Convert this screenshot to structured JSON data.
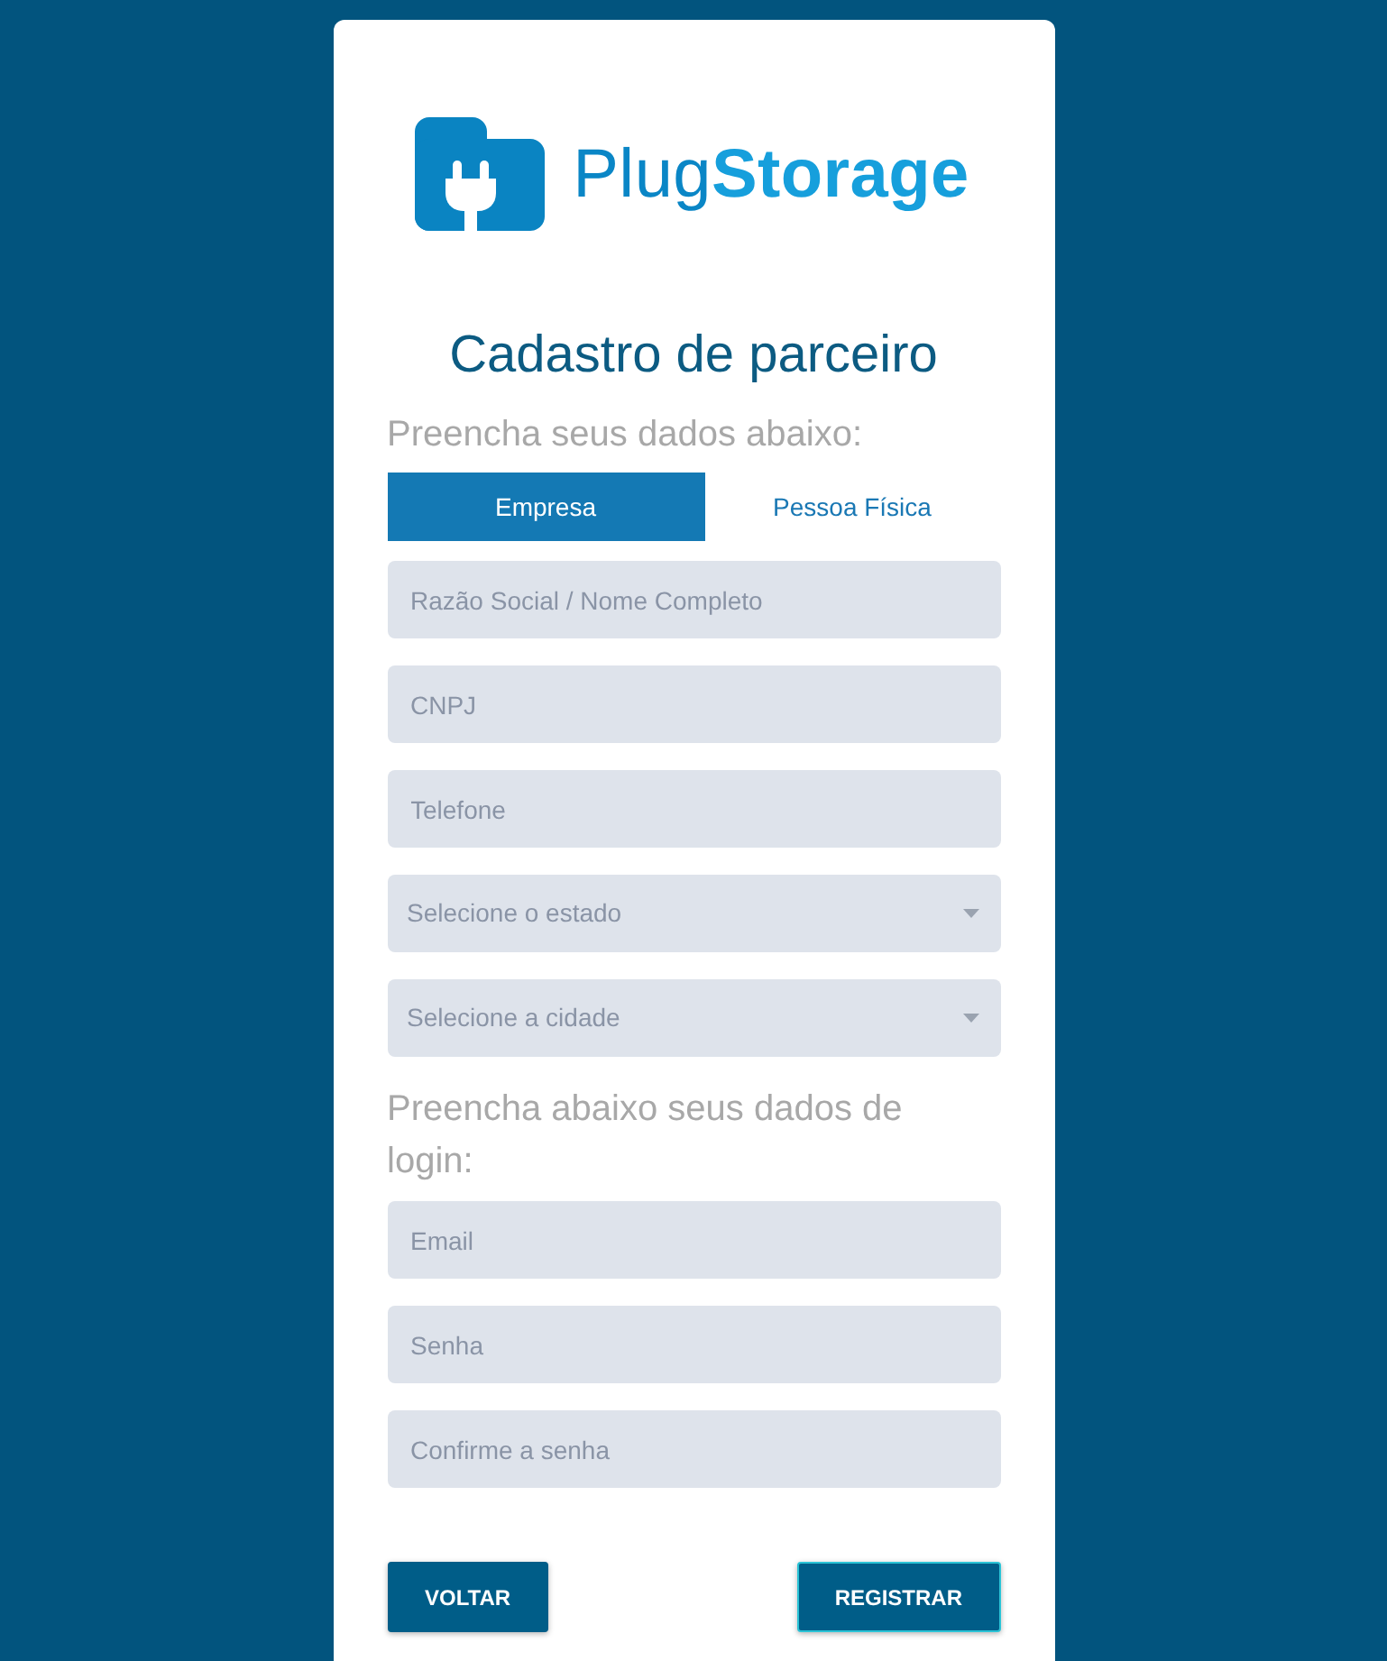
{
  "logo": {
    "text": "Plug**Storage**"
  },
  "title": "Cadastro de parceiro",
  "intro": "Preencha seus dados abaixo:",
  "tabs": [
    {
      "label": "Empresa",
      "selected": true
    },
    {
      "label": "Pessoa Física",
      "selected": false
    }
  ],
  "company_fields": [
    {
      "kind": "input",
      "placeholder": "Razão Social / Nome Completo"
    },
    {
      "kind": "input",
      "placeholder": "CNPJ"
    },
    {
      "kind": "input",
      "placeholder": "Telefone"
    },
    {
      "kind": "select",
      "placeholder": "Selecione o estado"
    },
    {
      "kind": "select",
      "placeholder": "Selecione a cidade"
    }
  ],
  "login_intro": "Preencha abaixo seus dados de login:",
  "login_fields": [
    {
      "kind": "input",
      "placeholder": "Email"
    },
    {
      "kind": "input",
      "placeholder": "Senha"
    },
    {
      "kind": "input",
      "placeholder": "Confirme a senha"
    }
  ],
  "buttons": [
    {
      "label": "VOLTAR",
      "focused": false
    },
    {
      "label": "REGISTRAR",
      "focused": true
    }
  ]
}
